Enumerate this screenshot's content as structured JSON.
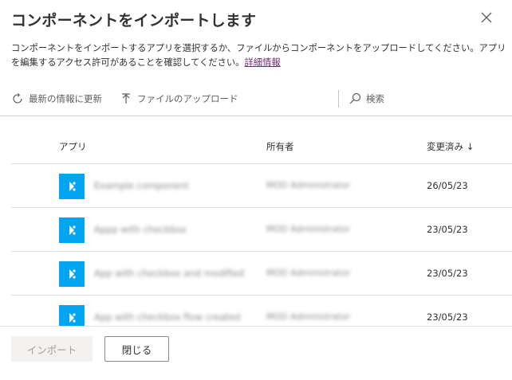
{
  "dialog": {
    "title": "コンポーネントをインポートします",
    "description": "コンポーネントをインポートするアプリを選択するか、ファイルからコンポーネントをアップロードしてください。アプリを編集するアクセス許可があることを確認してください。",
    "details_link": "詳細情報"
  },
  "toolbar": {
    "refresh_label": "最新の情報に更新",
    "upload_label": "ファイルのアップロード",
    "search_placeholder": "検索"
  },
  "table": {
    "columns": {
      "app": "アプリ",
      "owner": "所有者",
      "modified": "変更済み ↓"
    },
    "rows": [
      {
        "name": "Example component",
        "owner": "MOD Administrator",
        "modified": "26/05/23"
      },
      {
        "name": "Appp with checkbox",
        "owner": "MOD Administrator",
        "modified": "23/05/23"
      },
      {
        "name": "App with checkbox and modified",
        "owner": "MOD Administrator",
        "modified": "23/05/23"
      },
      {
        "name": "App with checkbox flow created",
        "owner": "MOD Administrator",
        "modified": "23/05/23"
      }
    ]
  },
  "footer": {
    "import_label": "インポート",
    "close_label": "閉じる"
  },
  "colors": {
    "app_icon": "#00a4ef",
    "link": "#742774"
  }
}
